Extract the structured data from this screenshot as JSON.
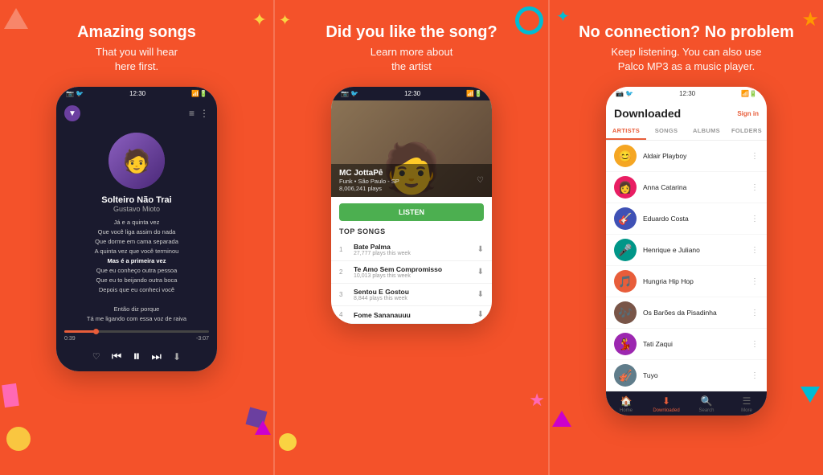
{
  "panel1": {
    "title": "Amazing songs",
    "subtitle": "That you will hear\nhere first.",
    "song": {
      "title": "Solteiro Não Trai",
      "artist": "Gustavo Mioto",
      "lyrics": [
        "Já e a quinta vez",
        "Que você liga assim do nada",
        "Que dorme em cama separada",
        "A quinta vez que você terminou",
        "Mas é a primeira vez",
        "Que eu conheço outra pessoa",
        "Que eu to beijando outra boca",
        "Depois que eu conheci você",
        "",
        "Então diz porque",
        "Tá me ligando com essa voz de raiva"
      ],
      "time_current": "0:39",
      "time_total": "-3:07"
    }
  },
  "panel2": {
    "title": "Did you like the song?",
    "subtitle": "Learn more about\nthe artist",
    "artist": {
      "name": "MC JottaPê",
      "genre": "Funk",
      "location": "São Paulo - SP",
      "plays": "8,006,241 plays"
    },
    "listen_label": "LISTEN",
    "top_songs_label": "TOP SONGS",
    "songs": [
      {
        "num": "1",
        "title": "Bate Palma",
        "plays": "27,777 plays this week"
      },
      {
        "num": "2",
        "title": "Te Amo Sem Compromisso",
        "plays": "10,013 plays this week"
      },
      {
        "num": "3",
        "title": "Sentou E Gostou",
        "plays": "8,844 plays this week"
      },
      {
        "num": "4",
        "title": "Fome Sananauuu",
        "plays": ""
      }
    ]
  },
  "panel3": {
    "title": "No connection? No problem",
    "subtitle": "Keep listening. You can also use\nPalco MP3 as a music player.",
    "screen": {
      "header": "Downloaded",
      "sign_in": "Sign in",
      "tabs": [
        "ARTISTS",
        "SONGS",
        "ALBUMS",
        "FOLDERS"
      ],
      "active_tab": "ARTISTS",
      "artists": [
        {
          "name": "Aldair Playboy",
          "emoji": "😊"
        },
        {
          "name": "Anna Catarina",
          "emoji": "👩"
        },
        {
          "name": "Eduardo Costa",
          "emoji": "🎸"
        },
        {
          "name": "Henrique e Juliano",
          "emoji": "🎤"
        },
        {
          "name": "Hungria Hip Hop",
          "emoji": "🎵"
        },
        {
          "name": "Os Barões da Pisadinha",
          "emoji": "🎶"
        },
        {
          "name": "Tati Zaqui",
          "emoji": "💃"
        },
        {
          "name": "Tuyo",
          "emoji": "🎻"
        }
      ],
      "nav_items": [
        {
          "label": "Home",
          "icon": "🏠",
          "active": false
        },
        {
          "label": "Downloaded",
          "icon": "⬇",
          "active": true
        },
        {
          "label": "Search",
          "icon": "🔍",
          "active": false
        },
        {
          "label": "More",
          "icon": "☰",
          "active": false
        }
      ]
    }
  },
  "statusbar": {
    "time": "12:30",
    "icons": "▲▲▲"
  }
}
